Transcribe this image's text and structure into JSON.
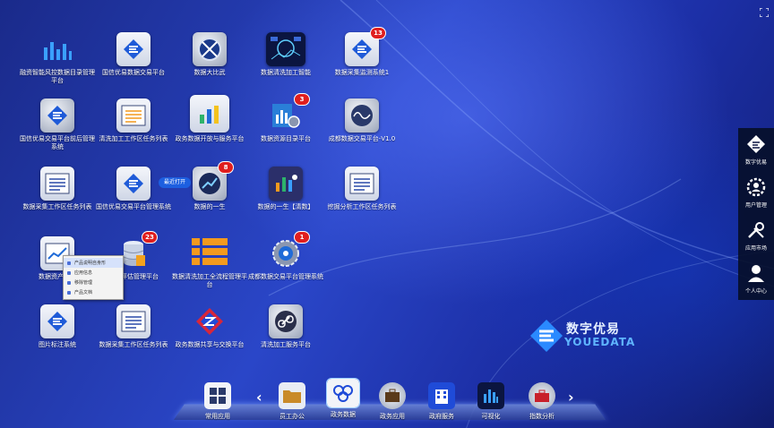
{
  "desktop": {
    "apps": [
      {
        "label": "融资智能风控数据目录管理平台",
        "icon": "bar-chart-icon",
        "badge": ""
      },
      {
        "label": "国信优易数据交易平台",
        "icon": "youedata-logo-icon",
        "badge": ""
      },
      {
        "label": "数据大比武",
        "icon": "globe-swords-icon",
        "badge": ""
      },
      {
        "label": "数据清洗加工智能",
        "icon": "dashboard-photo-icon",
        "badge": ""
      },
      {
        "label": "数据采集监测系统1",
        "icon": "youedata-logo-icon",
        "badge": "13"
      },
      {
        "label": "国信优易交易平台前后管理系统",
        "icon": "youedata-logo-icon",
        "badge": ""
      },
      {
        "label": "清洗加工工作区任务列表",
        "icon": "list-window-icon",
        "badge": ""
      },
      {
        "label": "政务数据开放与服务平台",
        "icon": "bar-chart-window-icon",
        "badge": ""
      },
      {
        "label": "数据资源目录平台",
        "icon": "gear-chart-icon",
        "badge": "3"
      },
      {
        "label": "成都数据交易平台-V1.0",
        "icon": "wave-circle-icon",
        "badge": ""
      },
      {
        "label": "数据采集工作区任务列表",
        "icon": "list-window-icon",
        "badge": ""
      },
      {
        "label": "国信优易交易平台管理系统",
        "icon": "youedata-logo-icon",
        "badge": ""
      },
      {
        "label": "数据的一生",
        "icon": "trend-circle-icon",
        "badge": "8"
      },
      {
        "label": "数据的一生【清数】",
        "icon": "people-chart-icon",
        "badge": ""
      },
      {
        "label": "挖掘分析工作区任务列表",
        "icon": "list-window-icon",
        "badge": ""
      },
      {
        "label": "数据资产评估",
        "icon": "chart-window-icon",
        "badge": ""
      },
      {
        "label": "资产评估管理平台",
        "icon": "database-icon",
        "badge": "23"
      },
      {
        "label": "数据清洗加工全流程管理平台",
        "icon": "orange-list-icon",
        "badge": ""
      },
      {
        "label": "成都数据交易平台管理系统",
        "icon": "eye-gear-icon",
        "badge": "1"
      },
      {
        "label": "图片标注系统",
        "icon": "youedata-logo-icon",
        "badge": ""
      },
      {
        "label": "数据采集工作区任务列表",
        "icon": "list-window-icon",
        "badge": ""
      },
      {
        "label": "政务数据共享与交换平台",
        "icon": "z-logo-icon",
        "badge": ""
      },
      {
        "label": "清洗加工服务平台",
        "icon": "link-circle-icon",
        "badge": ""
      }
    ]
  },
  "tooltip": {
    "text": "最近打开"
  },
  "context_menu": {
    "items": [
      {
        "label": "产品说明自身形",
        "active": true
      },
      {
        "label": "应用信息",
        "active": false
      },
      {
        "label": "移除管理",
        "active": false
      },
      {
        "label": "产品文档",
        "active": false
      }
    ]
  },
  "brand": {
    "name_cn": "数字优易",
    "name_en": "YOUEDATA"
  },
  "sidebar": {
    "items": [
      {
        "label": "数字优易",
        "icon": "youedata-logo-icon"
      },
      {
        "label": "用户管理",
        "icon": "gear-user-icon"
      },
      {
        "label": "应用市场",
        "icon": "tools-icon"
      },
      {
        "label": "个人中心",
        "icon": "person-icon"
      }
    ]
  },
  "dock": {
    "items": [
      {
        "label": "常用应用",
        "icon": "grid-icon",
        "active": false
      },
      {
        "label": "员工办公",
        "icon": "folder-icon",
        "active": false
      },
      {
        "label": "政务数据",
        "icon": "hexagons-icon",
        "active": true
      },
      {
        "label": "政务应用",
        "icon": "briefcase-icon",
        "active": false
      },
      {
        "label": "政府服务",
        "icon": "building-icon",
        "active": false
      },
      {
        "label": "可视化",
        "icon": "bars-icon",
        "active": false
      },
      {
        "label": "指数分析",
        "icon": "toolbox-icon",
        "active": false
      }
    ]
  },
  "colors": {
    "accent": "#1d5fe0",
    "badge": "#e01e1e",
    "orange": "#f39a1e"
  }
}
